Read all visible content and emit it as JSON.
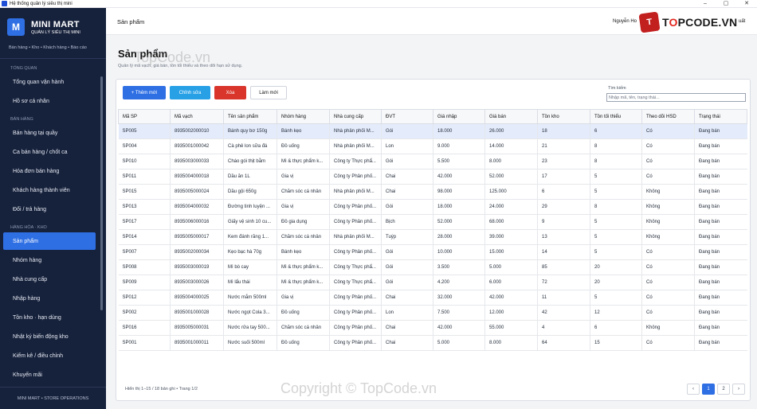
{
  "window": {
    "title": "Hệ thống quản lý siêu thị mini",
    "controls": [
      "–",
      "▢",
      "✕"
    ]
  },
  "sidebar": {
    "brand_logo": "M",
    "brand_title": "MINI MART",
    "brand_subtitle": "QUẢN LÝ SIÊU THỊ MINI",
    "tagline": "Bán hàng • Kho • Khách hàng • Báo cáo",
    "sections": [
      {
        "label": "TỔNG QUAN",
        "items": [
          "Tổng quan vận hành",
          "Hồ sơ cá nhân"
        ]
      },
      {
        "label": "BÁN HÀNG",
        "items": [
          "Bán hàng tại quầy",
          "Ca bán hàng / chốt ca",
          "Hóa đơn bán hàng",
          "Khách hàng thành viên",
          "Đổi / trả hàng"
        ]
      },
      {
        "label": "HÀNG HÓA · KHO",
        "items": [
          "Sản phẩm",
          "Nhóm hàng",
          "Nhà cung cấp",
          "Nhập hàng",
          "Tồn kho · hạn dùng",
          "Nhật ký biến động kho",
          "Kiểm kê / điều chỉnh",
          "Khuyến mãi"
        ]
      }
    ],
    "active_item": "Sản phẩm",
    "footer": "MINI MART • STORE OPERATIONS"
  },
  "header": {
    "title": "Sản phẩm",
    "user_prefix": "Nguyễn Ho",
    "user_suffix": "uất"
  },
  "watermark": {
    "logo_mark": "T",
    "logo_text_a": "T",
    "logo_text_o": "O",
    "logo_text_b": "PCODE.VN",
    "overlay_top": "TopCode.vn",
    "overlay_bottom": "Copyright © TopCode.vn"
  },
  "page": {
    "title": "Sản phẩm",
    "subtitle": "Quản lý mã vạch, giá bán, tồn tối thiểu và theo dõi hạn sử dụng."
  },
  "toolbar": {
    "add": "+ Thêm mới",
    "edit": "Chỉnh sửa",
    "delete": "Xóa",
    "reset": "Làm mới"
  },
  "search": {
    "label": "Tìm kiếm",
    "placeholder": "Nhập mã, tên, trạng thái..."
  },
  "table": {
    "columns": [
      "Mã SP",
      "Mã vạch",
      "Tên sản phẩm",
      "Nhóm hàng",
      "Nhà cung cấp",
      "ĐVT",
      "Giá nhập",
      "Giá bán",
      "Tồn kho",
      "Tồn tối thiểu",
      "Theo dõi HSD",
      "Trạng thái"
    ],
    "selected_row": 0,
    "rows": [
      [
        "SP005",
        "8935002000010",
        "Bánh quy bơ 150g",
        "Bánh kẹo",
        "Nhà phân phối M...",
        "Gói",
        "18.000",
        "26.000",
        "18",
        "6",
        "Có",
        "Đang bán"
      ],
      [
        "SP004",
        "8935001000042",
        "Cà phê lon sữa đá",
        "Đồ uống",
        "Nhà phân phối M...",
        "Lon",
        "9.000",
        "14.000",
        "21",
        "8",
        "Có",
        "Đang bán"
      ],
      [
        "SP010",
        "8935003000033",
        "Cháo gói thịt bằm",
        "Mì & thực phẩm k...",
        "Công ty Thực phẩ...",
        "Gói",
        "5.500",
        "8.000",
        "23",
        "8",
        "Có",
        "Đang bán"
      ],
      [
        "SP011",
        "8935004000018",
        "Dầu ăn 1L",
        "Gia vị",
        "Công ty Phân phố...",
        "Chai",
        "42.000",
        "52.000",
        "17",
        "5",
        "Có",
        "Đang bán"
      ],
      [
        "SP015",
        "8935005000024",
        "Dầu gội 650g",
        "Chăm sóc cá nhân",
        "Nhà phân phối M...",
        "Chai",
        "98.000",
        "125.000",
        "6",
        "5",
        "Không",
        "Đang bán"
      ],
      [
        "SP013",
        "8935004000032",
        "Đường tinh luyện ...",
        "Gia vị",
        "Công ty Phân phố...",
        "Gói",
        "18.000",
        "24.000",
        "29",
        "8",
        "Không",
        "Đang bán"
      ],
      [
        "SP017",
        "8935006000016",
        "Giấy vệ sinh 10 cu...",
        "Đồ gia dụng",
        "Công ty Phân phố...",
        "Bịch",
        "52.000",
        "68.000",
        "9",
        "5",
        "Không",
        "Đang bán"
      ],
      [
        "SP014",
        "8935005000017",
        "Kem đánh răng 1...",
        "Chăm sóc cá nhân",
        "Nhà phân phối M...",
        "Tuýp",
        "28.000",
        "39.000",
        "13",
        "5",
        "Không",
        "Đang bán"
      ],
      [
        "SP007",
        "8935002000034",
        "Kẹo bạc hà 70g",
        "Bánh kẹo",
        "Công ty Phân phố...",
        "Gói",
        "10.000",
        "15.000",
        "14",
        "5",
        "Có",
        "Đang bán"
      ],
      [
        "SP008",
        "8935003000019",
        "Mì bò cay",
        "Mì & thực phẩm k...",
        "Công ty Thực phẩ...",
        "Gói",
        "3.500",
        "5.000",
        "85",
        "20",
        "Có",
        "Đang bán"
      ],
      [
        "SP009",
        "8935003000026",
        "Mì lẩu thái",
        "Mì & thực phẩm k...",
        "Công ty Thực phẩ...",
        "Gói",
        "4.200",
        "6.000",
        "72",
        "20",
        "Có",
        "Đang bán"
      ],
      [
        "SP012",
        "8935004000025",
        "Nước mắm 500ml",
        "Gia vị",
        "Công ty Phân phố...",
        "Chai",
        "32.000",
        "42.000",
        "11",
        "5",
        "Có",
        "Đang bán"
      ],
      [
        "SP002",
        "8935001000028",
        "Nước ngọt Cola 3...",
        "Đồ uống",
        "Công ty Phân phố...",
        "Lon",
        "7.500",
        "12.000",
        "42",
        "12",
        "Có",
        "Đang bán"
      ],
      [
        "SP016",
        "8935005000031",
        "Nước rửa tay 500...",
        "Chăm sóc cá nhân",
        "Công ty Phân phố...",
        "Chai",
        "42.000",
        "55.000",
        "4",
        "6",
        "Không",
        "Đang bán"
      ],
      [
        "SP001",
        "8935001000011",
        "Nước suối 500ml",
        "Đồ uống",
        "Công ty Phân phố...",
        "Chai",
        "5.000",
        "8.000",
        "64",
        "15",
        "Có",
        "Đang bán"
      ]
    ]
  },
  "pagination": {
    "info": "Hiển thị 1–15 / 18 bản ghi • Trang 1/2",
    "prev": "‹",
    "pages": [
      "1",
      "2"
    ],
    "current": "1",
    "next": "›"
  },
  "colors": {
    "sidebar_bg": "#16213b",
    "accent": "#2f6fe4",
    "danger": "#d9352b",
    "info": "#27a0e6",
    "selected_row": "#e4ecfb"
  }
}
